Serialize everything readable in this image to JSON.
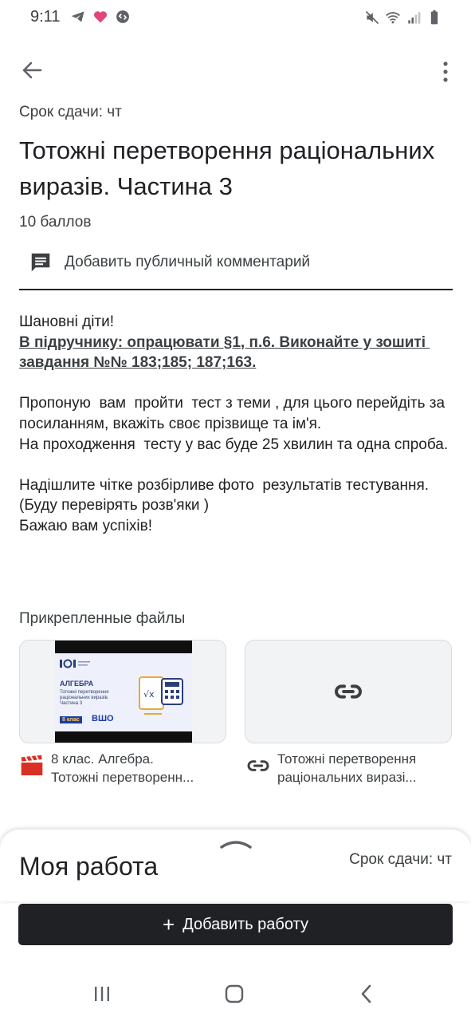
{
  "status_bar": {
    "time": "9:11",
    "left_icons": [
      "telegram-icon",
      "heart-icon",
      "shazam-icon"
    ],
    "right_icons": [
      "mute-icon",
      "wifi-icon",
      "signal-icon",
      "battery-icon"
    ]
  },
  "app_bar": {
    "back_icon": "arrow-back-icon",
    "more_icon": "more-vert-icon"
  },
  "assignment": {
    "due_label": "Срок сдачи: чт",
    "title": "Тотожні перетворення раціональних виразів. Частина 3",
    "points": "10 баллов",
    "comment_label": "Добавить публичный комментарий",
    "description": {
      "greeting": "Шановні діти!",
      "bold_instruction": "В підручнику: опрацювати §1, п.6. Виконайте у зошиті завдання №№ 183;185; 187;163.",
      "paragraph_1": "Пропоную  вам  пройти  тест з теми , для цього перейдіть за посиланням, вкажіть своє прізвище та ім'я.",
      "paragraph_2": "На проходження  тесту у вас буде 25 хвилин та одна спроба.",
      "paragraph_3": "Надішлите чітке розбірливе фото  результатів тестування.(Буду перевірять розв'яки )",
      "paragraph_4": "Бажаю вам успіхів!"
    }
  },
  "attachments": {
    "header": "Прикрепленные файлы",
    "video": {
      "line_1": "8 клас. Алгебра.",
      "line_2": "Тотожні перетворенн...",
      "thumb_title": "АЛГЕБРА",
      "thumb_subtitle": "Тотожні перетворення раціональних виразів. Частина 3",
      "thumb_badge": "8 клас",
      "thumb_brand": "ВШО",
      "icon": "video-clapper-icon"
    },
    "link": {
      "line_1": "Тотожні перетворення",
      "line_2": "раціональних виразі...",
      "icon": "link-icon"
    }
  },
  "my_work": {
    "title": "Моя работа",
    "due": "Срок сдачи: чт",
    "add_button_label": "Добавить работу",
    "add_icon": "plus-icon"
  },
  "nav_bar": {
    "icons": [
      "recents-icon",
      "home-icon",
      "back-nav-icon"
    ]
  },
  "colors": {
    "text_primary": "#202124",
    "text_secondary": "#3c4043",
    "button_bg": "#202124",
    "video_icon": "#d93025",
    "card_bg": "#f1f3f4"
  }
}
